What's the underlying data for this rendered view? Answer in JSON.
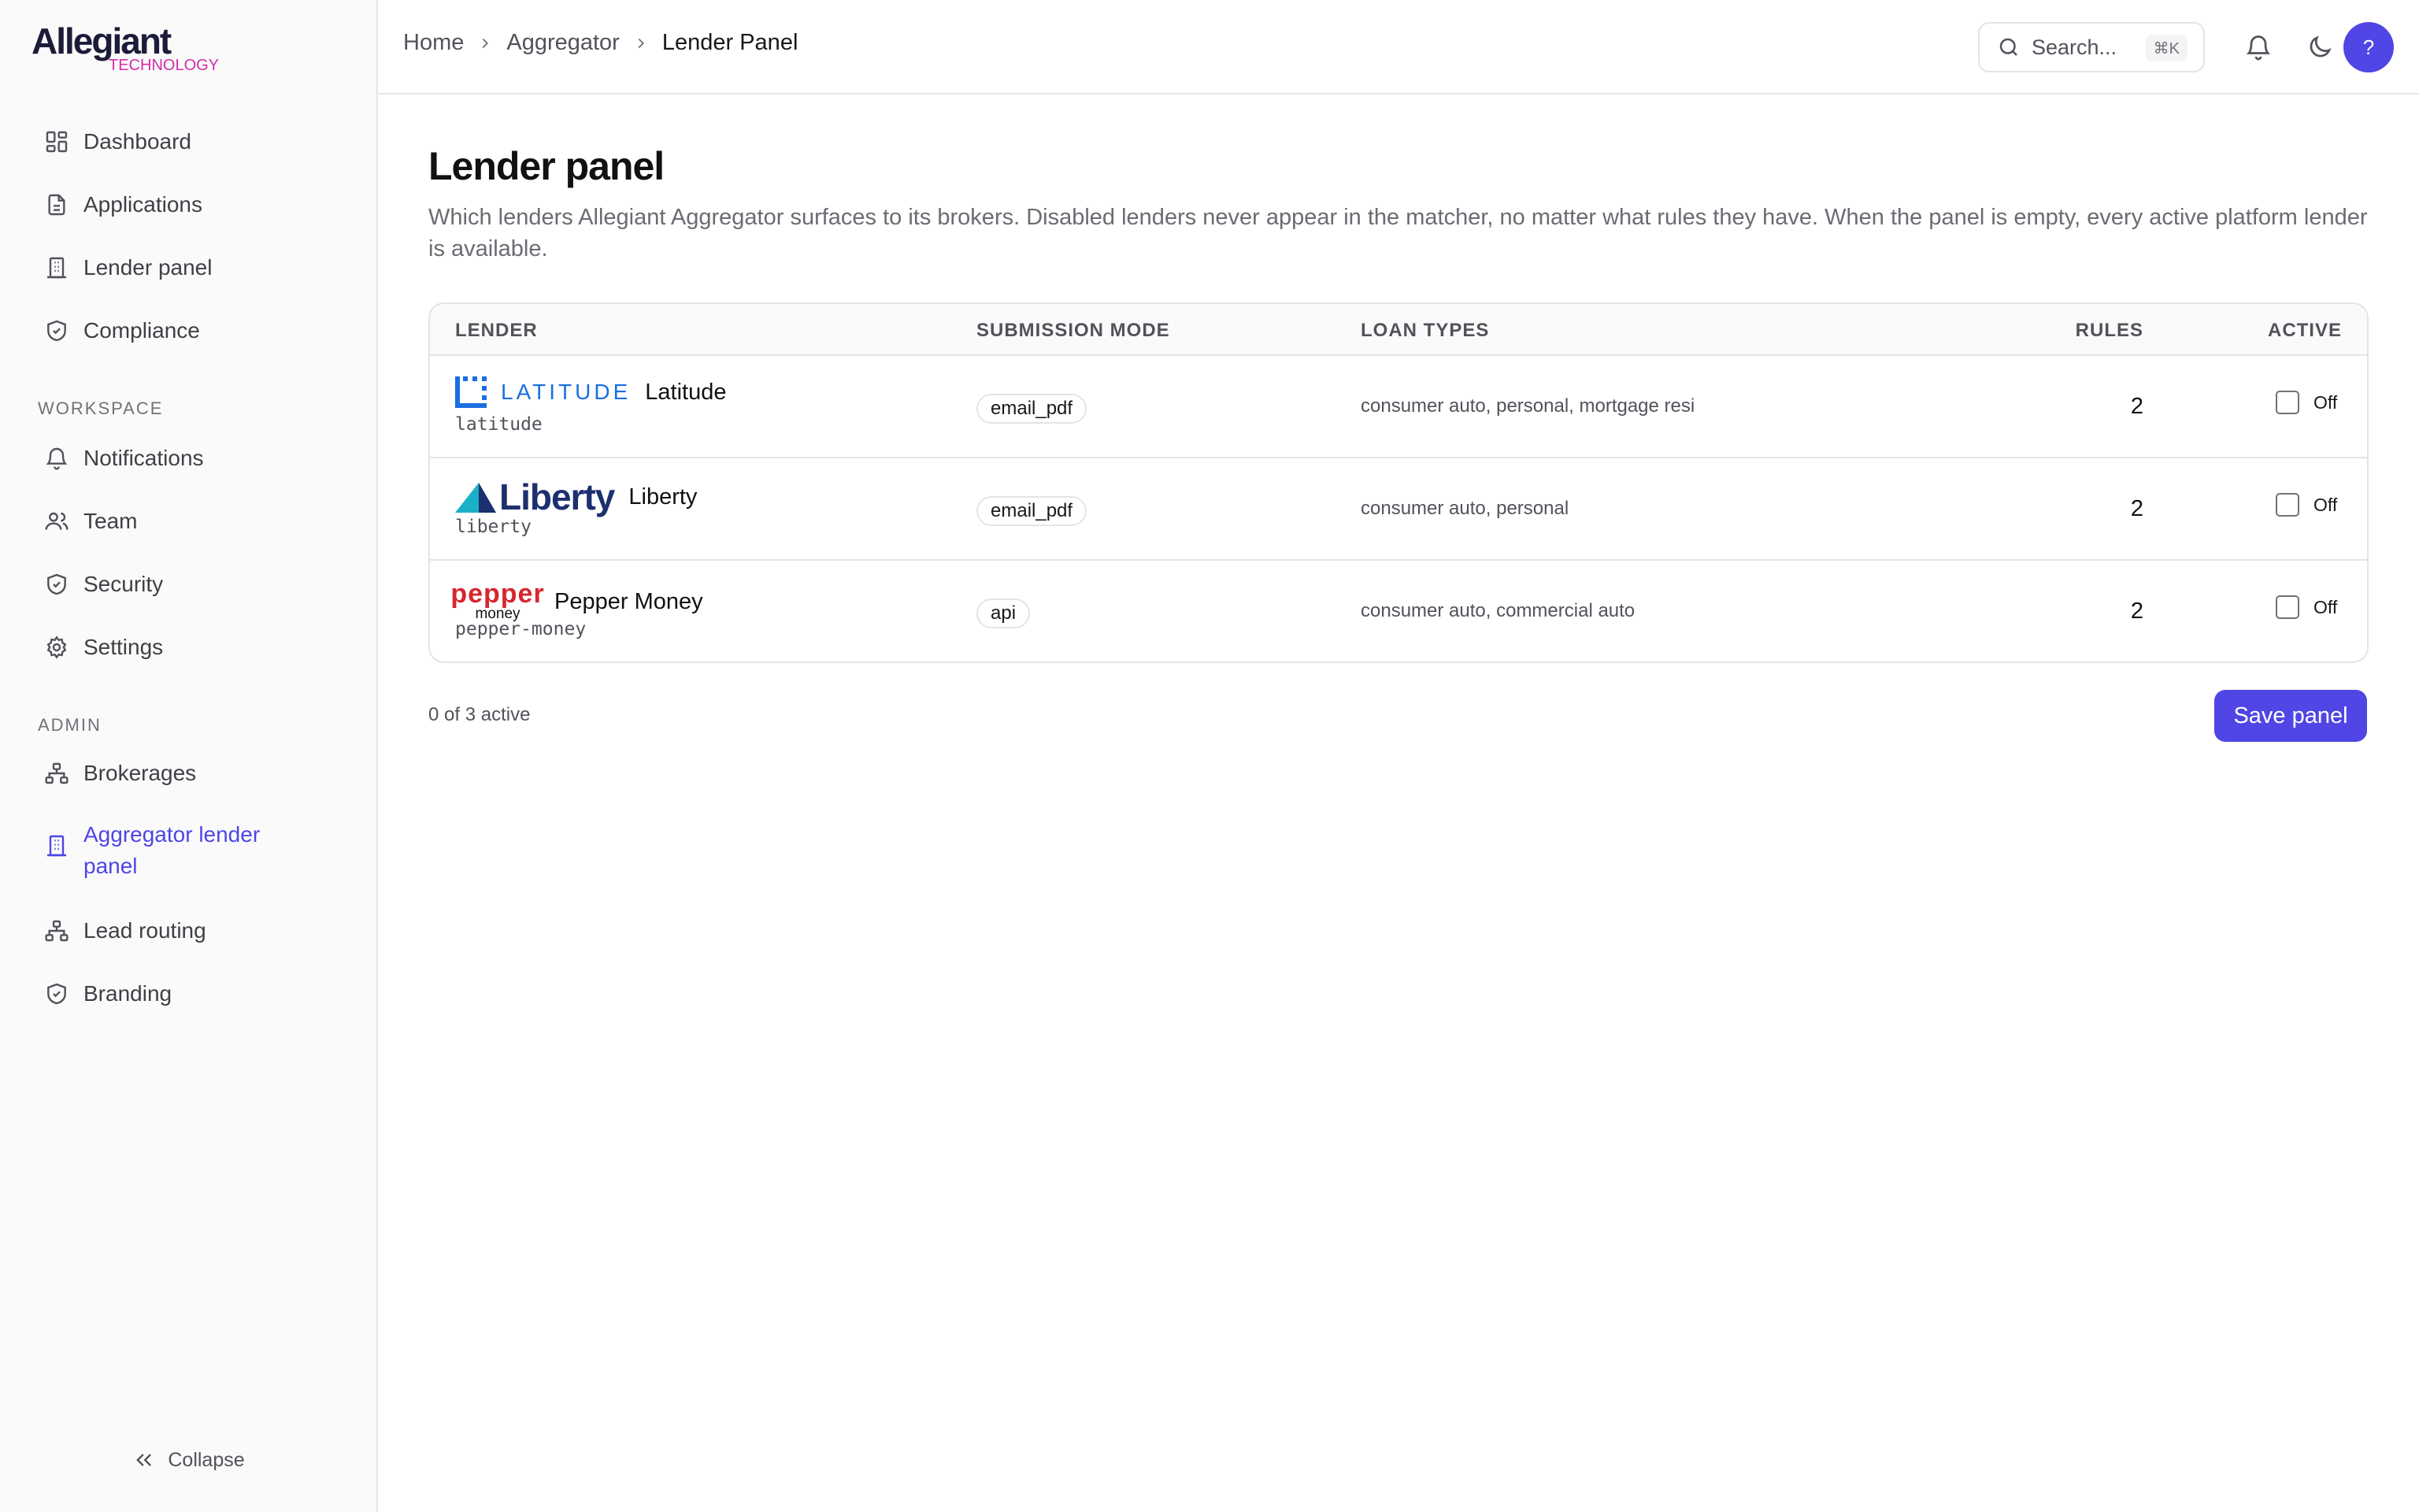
{
  "brand": {
    "name": "Allegiant",
    "sub": "TECHNOLOGY"
  },
  "sidebar": {
    "main": [
      {
        "label": "Dashboard",
        "icon": "dashboard-icon"
      },
      {
        "label": "Applications",
        "icon": "file-icon"
      },
      {
        "label": "Lender panel",
        "icon": "building-icon"
      },
      {
        "label": "Compliance",
        "icon": "shield-check-icon"
      }
    ],
    "workspace_label": "WORKSPACE",
    "workspace": [
      {
        "label": "Notifications",
        "icon": "bell-icon"
      },
      {
        "label": "Team",
        "icon": "users-icon"
      },
      {
        "label": "Security",
        "icon": "shield-check-icon"
      },
      {
        "label": "Settings",
        "icon": "gear-icon"
      }
    ],
    "admin_label": "ADMIN",
    "admin": [
      {
        "label": "Brokerages",
        "icon": "network-icon"
      },
      {
        "label": "Aggregator lender panel",
        "icon": "building-icon",
        "active": true
      },
      {
        "label": "Lead routing",
        "icon": "network-icon"
      },
      {
        "label": "Branding",
        "icon": "shield-check-icon"
      }
    ],
    "collapse_label": "Collapse"
  },
  "header": {
    "breadcrumb": [
      "Home",
      "Aggregator",
      "Lender Panel"
    ],
    "search_placeholder": "Search...",
    "search_shortcut": "⌘K",
    "avatar_initial": "?"
  },
  "page": {
    "title": "Lender panel",
    "description": "Which lenders Allegiant Aggregator surfaces to its brokers. Disabled lenders never appear in the matcher, no matter what rules they have. When the panel is empty, every active platform lender is available."
  },
  "table": {
    "columns": {
      "lender": "LENDER",
      "submission_mode": "SUBMISSION MODE",
      "loan_types": "LOAN TYPES",
      "rules": "RULES",
      "active": "ACTIVE"
    },
    "rows": [
      {
        "logo_text": "LATITUDE",
        "name": "Latitude",
        "slug": "latitude",
        "submission_mode": "email_pdf",
        "loan_types": "consumer auto, personal, mortgage resi",
        "rules": "2",
        "active_label": "Off"
      },
      {
        "logo_text": "Liberty",
        "name": "Liberty",
        "slug": "liberty",
        "submission_mode": "email_pdf",
        "loan_types": "consumer auto, personal",
        "rules": "2",
        "active_label": "Off"
      },
      {
        "logo_text": "pepper",
        "logo_sub": "money",
        "name": "Pepper Money",
        "slug": "pepper-money",
        "submission_mode": "api",
        "loan_types": "consumer auto, commercial auto",
        "rules": "2",
        "active_label": "Off"
      }
    ]
  },
  "footer": {
    "active_count": "0 of 3 active",
    "save_label": "Save panel"
  },
  "colors": {
    "accent": "#4f46e5",
    "brand_sub": "#d42da7",
    "latitude": "#1a6fe0",
    "liberty": "#1c2f6e",
    "pepper": "#d8262e"
  }
}
